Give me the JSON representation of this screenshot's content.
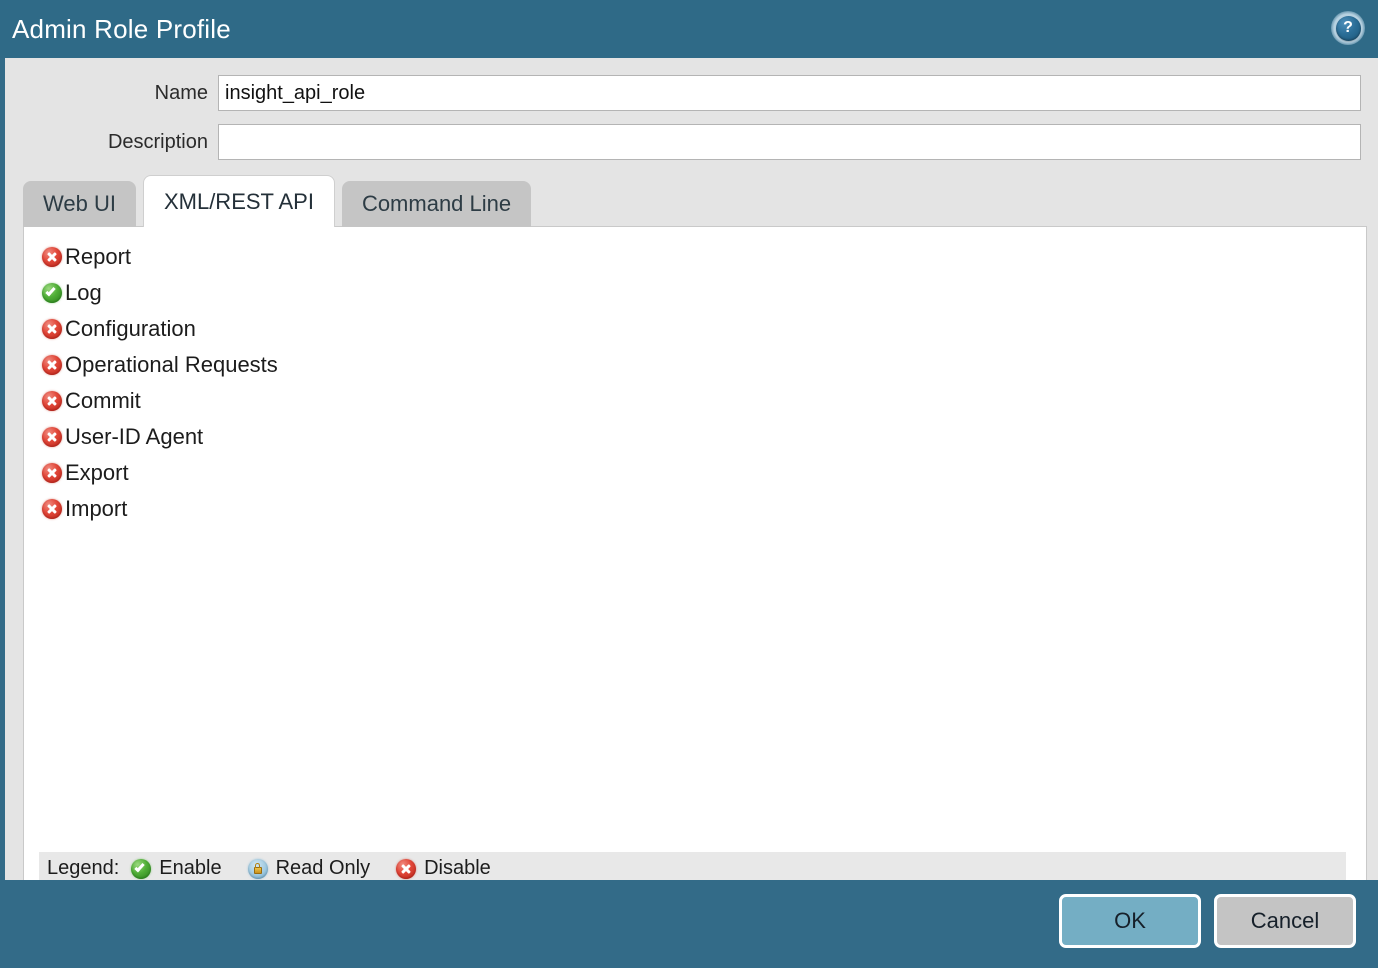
{
  "window": {
    "title": "Admin Role Profile",
    "help_icon": "help-circle-icon",
    "help_glyph": "?"
  },
  "form": {
    "name_label": "Name",
    "name_value": "insight_api_role",
    "name_placeholder": "",
    "description_label": "Description",
    "description_value": "",
    "description_placeholder": ""
  },
  "tabs": [
    {
      "label": "Web UI",
      "active": false
    },
    {
      "label": "XML/REST API",
      "active": true
    },
    {
      "label": "Command Line",
      "active": false
    }
  ],
  "permissions": [
    {
      "label": "Report",
      "state": "disable",
      "icon": "disable-icon"
    },
    {
      "label": "Log",
      "state": "enable",
      "icon": "enable-icon"
    },
    {
      "label": "Configuration",
      "state": "disable",
      "icon": "disable-icon"
    },
    {
      "label": "Operational Requests",
      "state": "disable",
      "icon": "disable-icon"
    },
    {
      "label": "Commit",
      "state": "disable",
      "icon": "disable-icon"
    },
    {
      "label": "User-ID Agent",
      "state": "disable",
      "icon": "disable-icon"
    },
    {
      "label": "Export",
      "state": "disable",
      "icon": "disable-icon"
    },
    {
      "label": "Import",
      "state": "disable",
      "icon": "disable-icon"
    }
  ],
  "legend": {
    "title": "Legend:",
    "entries": [
      {
        "label": "Enable",
        "state": "enable",
        "icon": "enable-icon"
      },
      {
        "label": "Read Only",
        "state": "readonly",
        "icon": "lock-icon"
      },
      {
        "label": "Disable",
        "state": "disable",
        "icon": "disable-icon"
      }
    ]
  },
  "footer": {
    "ok_label": "OK",
    "cancel_label": "Cancel"
  },
  "colors": {
    "titlebar": "#2f6a87",
    "backdrop": "#336b88",
    "panel": "#e4e4e4",
    "tab_inactive": "#c5c5c5",
    "tab_active": "#ffffff",
    "legend_bar": "#e8e8e8",
    "ok_button": "#74aec4",
    "cancel_button": "#c4c4c4",
    "enable": "#4fae36",
    "disable": "#e2483a",
    "readonly": "#9fc9e0"
  }
}
